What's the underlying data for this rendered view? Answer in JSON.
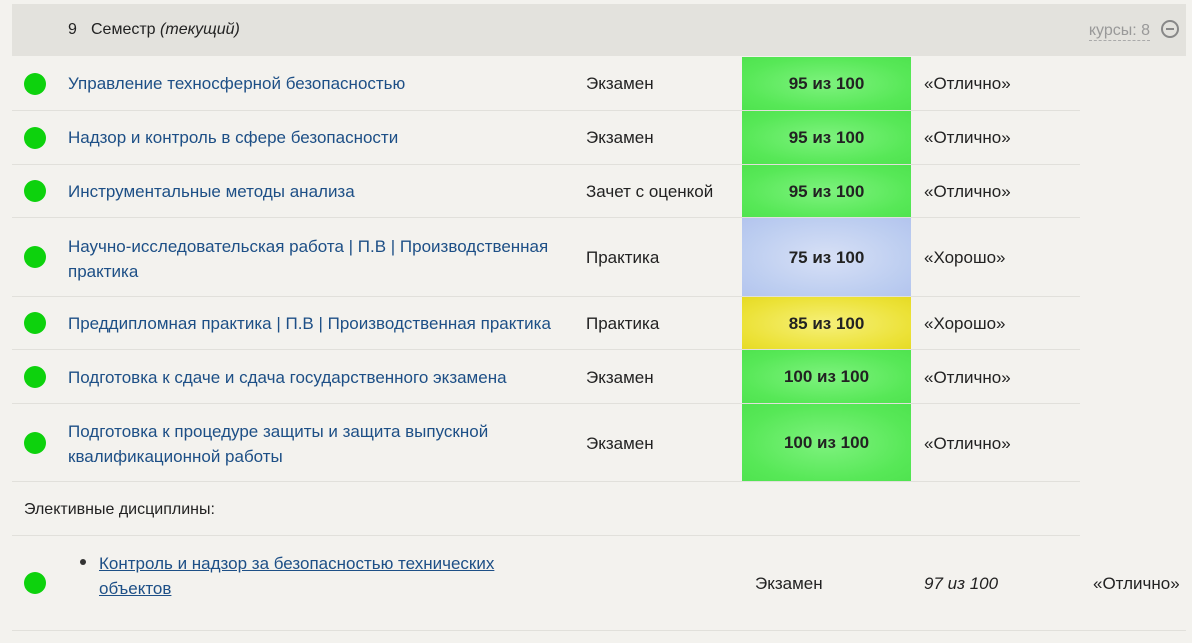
{
  "semester": {
    "number": "9",
    "label": "Семестр",
    "current": "(текущий)",
    "courses_label": "курсы: 8"
  },
  "rows": [
    {
      "course": "Управление техносферной безопасностью",
      "type": "Экзамен",
      "score": "95 из 100",
      "grade": "«Отлично»",
      "score_color": "green"
    },
    {
      "course": "Надзор и контроль в сфере безопасности",
      "type": "Экзамен",
      "score": "95 из 100",
      "grade": "«Отлично»",
      "score_color": "green"
    },
    {
      "course": "Инструментальные методы анализа",
      "type": "Зачет с оценкой",
      "score": "95 из 100",
      "grade": "«Отлично»",
      "score_color": "green"
    },
    {
      "course": "Научно-исследовательская работа | П.В | Производственная практика",
      "type": "Практика",
      "score": "75 из 100",
      "grade": "«Хорошо»",
      "score_color": "blue"
    },
    {
      "course": "Преддипломная практика | П.В | Производственная практика",
      "type": "Практика",
      "score": "85 из 100",
      "grade": "«Хорошо»",
      "score_color": "yellow"
    },
    {
      "course": "Подготовка к сдаче и сдача государственного экзамена",
      "type": "Экзамен",
      "score": "100 из 100",
      "grade": "«Отлично»",
      "score_color": "green"
    },
    {
      "course": "Подготовка к процедуре защиты и защита выпускной квалификационной работы",
      "type": "Экзамен",
      "score": "100 из 100",
      "grade": "«Отлично»",
      "score_color": "green"
    }
  ],
  "electives": {
    "label": "Элективные дисциплины:",
    "items": [
      {
        "course": "Контроль и надзор за безопасностью технических объектов",
        "type": "Экзамен",
        "score": "97 из 100",
        "grade": "«Отлично»"
      }
    ]
  },
  "colors": {
    "status_dot": "#0dd20d",
    "link": "#1d4f86",
    "score_green": "#57e857",
    "score_blue": "#bccdf0",
    "score_yellow": "#ece238"
  }
}
